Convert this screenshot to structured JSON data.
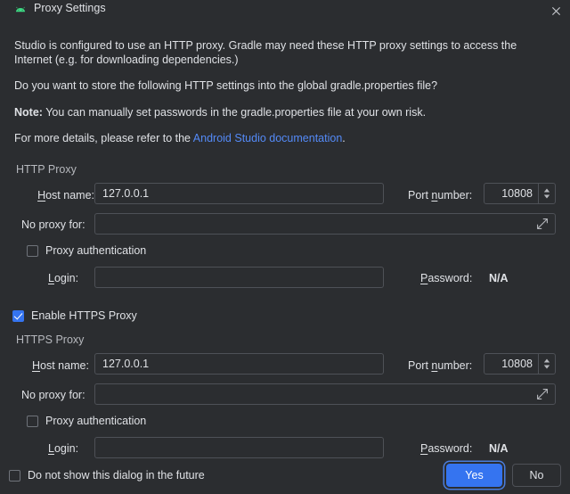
{
  "window": {
    "title": "Proxy Settings",
    "icon": "android-studio-icon",
    "close_label": "✕",
    "bg_color": "#2b2d30"
  },
  "body": {
    "paragraph1": "Studio is configured to use an HTTP proxy. Gradle may need these HTTP proxy settings to access the Internet (e.g. for downloading dependencies.)",
    "paragraph2": "Do you want to store the following HTTP settings into the global gradle.properties file?",
    "note_prefix": "Note:",
    "note_text": " You can manually set passwords in the gradle.properties file at your own risk.",
    "details_prefix": "For more details, please refer to the ",
    "details_link": "Android Studio documentation",
    "details_suffix": ".",
    "link_color": "#548af7"
  },
  "http_section": {
    "title": "HTTP Proxy",
    "host_label": "Host name:",
    "host_mnemonic": "H",
    "host_value": "127.0.0.1",
    "port_label": "Port number:",
    "port_mnemonic": "n",
    "port_value": "10808",
    "noproxy_label": "No proxy for:",
    "noproxy_value": "",
    "auth_label": "Proxy authentication",
    "auth_checked": false,
    "login_label": "Login:",
    "login_mnemonic": "L",
    "login_value": "",
    "password_label": "Password:",
    "password_mnemonic": "P",
    "password_value": "N/A"
  },
  "enable_https": {
    "label": "Enable HTTPS Proxy",
    "checked": true,
    "accent_color": "#3574f0"
  },
  "https_section": {
    "title": "HTTPS Proxy",
    "host_label": "Host name:",
    "host_mnemonic": "H",
    "host_value": "127.0.0.1",
    "port_label": "Port number:",
    "port_mnemonic": "n",
    "port_value": "10808",
    "noproxy_label": "No proxy for:",
    "noproxy_value": "",
    "auth_label": "Proxy authentication",
    "auth_checked": false,
    "login_label": "Login:",
    "login_mnemonic": "L",
    "login_value": "",
    "password_label": "Password:",
    "password_mnemonic": "P",
    "password_value": "N/A"
  },
  "footer": {
    "dont_show_label": "Do not show this dialog in the future",
    "dont_show_checked": false,
    "yes_label": "Yes",
    "no_label": "No",
    "primary_color": "#3574f0"
  }
}
